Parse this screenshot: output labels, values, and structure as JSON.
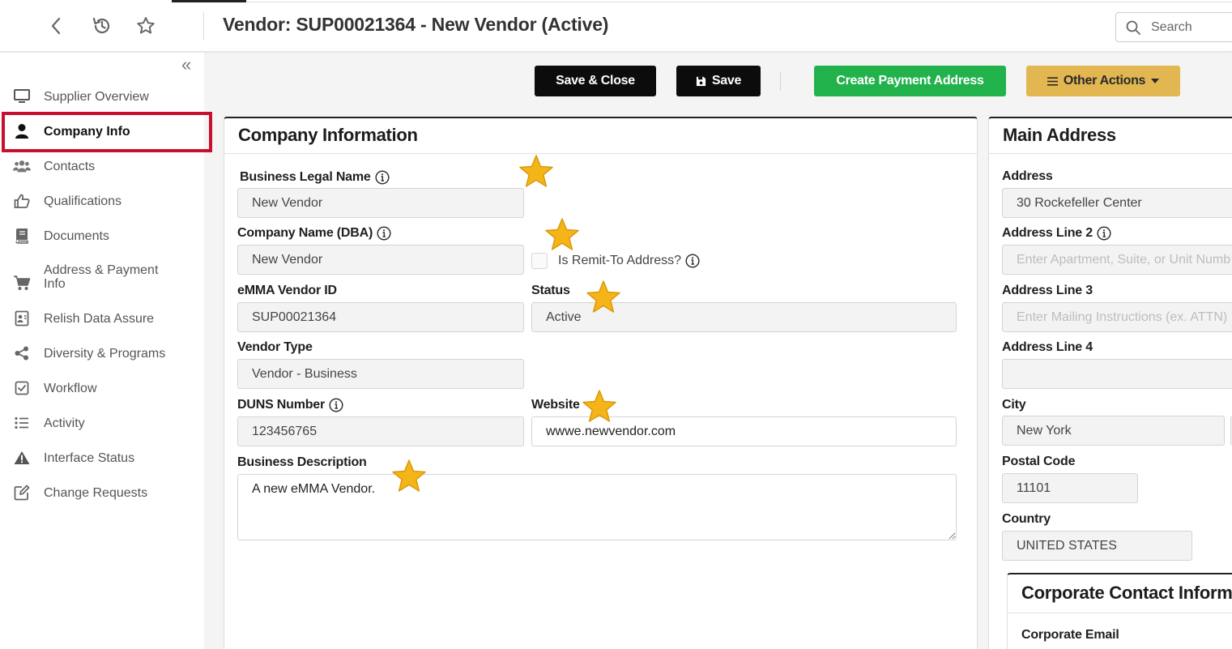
{
  "header": {
    "title": "Vendor: SUP00021364 - New Vendor (Active)",
    "search_placeholder": "Search"
  },
  "sidebar": {
    "items": [
      {
        "label": "Supplier Overview",
        "icon": "monitor-icon"
      },
      {
        "label": "Company Info",
        "icon": "user-icon",
        "active": true
      },
      {
        "label": "Contacts",
        "icon": "users-icon"
      },
      {
        "label": "Qualifications",
        "icon": "thumbs-up-icon"
      },
      {
        "label": "Documents",
        "icon": "book-icon"
      },
      {
        "label": "Address & Payment Info",
        "icon": "cart-icon"
      },
      {
        "label": "Relish Data Assure",
        "icon": "id-card-icon"
      },
      {
        "label": "Diversity & Programs",
        "icon": "share-icon"
      },
      {
        "label": "Workflow",
        "icon": "check-square-icon"
      },
      {
        "label": "Activity",
        "icon": "list-icon"
      },
      {
        "label": "Interface Status",
        "icon": "warning-icon"
      },
      {
        "label": "Change Requests",
        "icon": "edit-icon"
      }
    ]
  },
  "toolbar": {
    "save_close": "Save & Close",
    "save": "Save",
    "create_payment": "Create Payment Address",
    "other_actions": "Other Actions"
  },
  "company": {
    "heading": "Company Information",
    "legal_name_label": "Business Legal Name",
    "legal_name": "New Vendor",
    "dba_label": "Company Name (DBA)",
    "dba": "New Vendor",
    "remit_label": "Is Remit-To Address?",
    "vendor_id_label": "eMMA Vendor ID",
    "vendor_id": "SUP00021364",
    "status_label": "Status",
    "status": "Active",
    "vendor_type_label": "Vendor Type",
    "vendor_type": "Vendor - Business",
    "duns_label": "DUNS Number",
    "duns": "123456765",
    "website_label": "Website",
    "website": "wwwe.newvendor.com",
    "description_label": "Business Description",
    "description": "A new eMMA Vendor."
  },
  "address": {
    "heading": "Main Address",
    "address_label": "Address",
    "address": "30 Rockefeller Center",
    "line2_label": "Address Line 2",
    "line2_placeholder": "Enter Apartment, Suite, or Unit Number",
    "line3_label": "Address Line 3",
    "line3_placeholder": "Enter Mailing Instructions (ex. ATTN)",
    "line4_label": "Address Line 4",
    "city_label": "City",
    "city": "New York",
    "postal_label": "Postal Code",
    "postal": "11101",
    "country_label": "Country",
    "country": "UNITED STATES"
  },
  "corporate": {
    "heading": "Corporate Contact Information",
    "email_label": "Corporate Email"
  },
  "colors": {
    "highlight": "#c8102e",
    "green": "#22b24c",
    "gold": "#e2b651",
    "dark": "#0c0c0c",
    "star": "#f5b417"
  }
}
